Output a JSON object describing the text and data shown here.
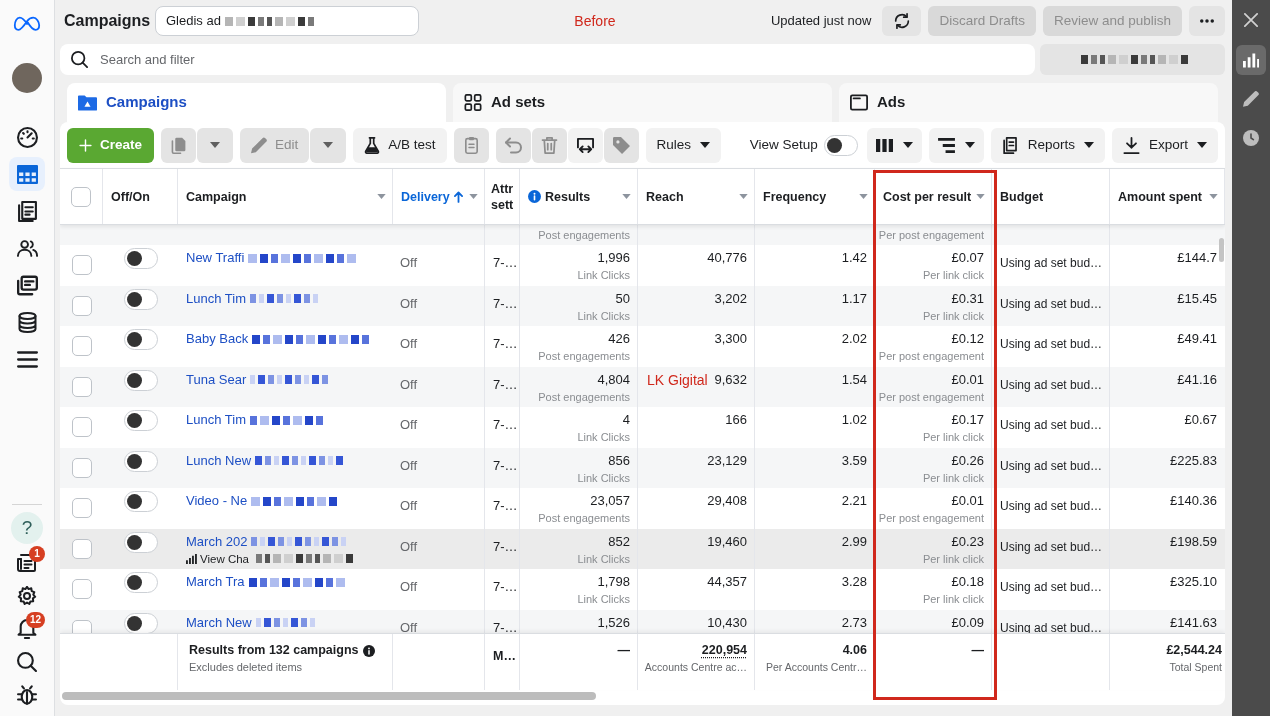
{
  "nav": {
    "top": [
      {
        "selected": false
      },
      {
        "selected": true
      },
      {
        "selected": false
      },
      {
        "selected": false
      },
      {
        "selected": false
      },
      {
        "selected": false
      },
      {
        "selected": false
      }
    ],
    "bottom": [
      {
        "kind": "help",
        "label": "?"
      },
      {
        "kind": "icon",
        "badge": "1"
      },
      {
        "kind": "icon"
      },
      {
        "kind": "icon",
        "badge": "12"
      },
      {
        "kind": "icon"
      },
      {
        "kind": "icon"
      }
    ]
  },
  "header": {
    "title": "Campaigns",
    "account": "Gledis ad",
    "annotation": "Before",
    "updated": "Updated just now",
    "actions": [
      {
        "label": "Discard Drafts",
        "disabled": true
      },
      {
        "label": "Review and publish",
        "disabled": true
      }
    ]
  },
  "search": {
    "placeholder": "Search and filter"
  },
  "tabs": [
    {
      "label": "Campaigns",
      "selected": true
    },
    {
      "label": "Ad sets",
      "selected": false
    },
    {
      "label": "Ads",
      "selected": false
    }
  ],
  "toolbar": {
    "left": [
      {
        "items": [
          {
            "kind": "primary",
            "label": "Create"
          }
        ]
      },
      {
        "items": [
          {
            "kind": "icon",
            "disabled": true
          },
          {
            "kind": "caret",
            "disabled": true
          }
        ]
      },
      {
        "items": [
          {
            "kind": "button",
            "label": "Edit",
            "disabled": true
          },
          {
            "kind": "caret",
            "disabled": true
          }
        ]
      },
      {
        "items": [
          {
            "kind": "button",
            "label": "A/B test",
            "disabled": false
          }
        ]
      },
      {
        "items": [
          {
            "kind": "icon",
            "disabled": true
          }
        ]
      },
      {
        "items": [
          {
            "kind": "icon",
            "disabled": true
          },
          {
            "kind": "icon",
            "disabled": true
          },
          {
            "kind": "icon",
            "disabled": false
          },
          {
            "kind": "icon",
            "disabled": true
          }
        ]
      },
      {
        "items": [
          {
            "kind": "dropdown",
            "label": "Rules",
            "disabled": false
          }
        ]
      }
    ],
    "right": [
      {
        "kind": "toggle",
        "label": "View Setup",
        "on": false
      },
      {
        "kind": "icon_dropdown"
      },
      {
        "kind": "icon_dropdown"
      },
      {
        "kind": "dropdown",
        "label": "Reports",
        "disabled": false
      },
      {
        "kind": "dropdown",
        "label": "Export",
        "disabled": false
      }
    ]
  },
  "table": {
    "select_all": {
      "checked": false
    },
    "columns": [
      {
        "label": "Off/On",
        "menu": false,
        "sorted": false,
        "info": false,
        "highlighted": false
      },
      {
        "label": "Campaign",
        "menu": true,
        "sorted": false,
        "info": false,
        "highlighted": false
      },
      {
        "label": "Delivery",
        "menu": true,
        "sorted": true,
        "info": false,
        "highlighted": false
      },
      {
        "label": "Attr sett",
        "menu": false,
        "sorted": false,
        "info": false,
        "highlighted": false
      },
      {
        "label": "Results",
        "menu": true,
        "sorted": false,
        "info": true,
        "highlighted": false
      },
      {
        "label": "Reach",
        "menu": true,
        "sorted": false,
        "info": false,
        "highlighted": false
      },
      {
        "label": "Frequency",
        "menu": true,
        "sorted": false,
        "info": false,
        "highlighted": false
      },
      {
        "label": "Cost per result",
        "menu": true,
        "sorted": false,
        "info": false,
        "highlighted": true
      },
      {
        "label": "Budget",
        "menu": false,
        "sorted": false,
        "info": false,
        "highlighted": false
      },
      {
        "label": "Amount spent",
        "menu": true,
        "sorted": false,
        "info": false,
        "highlighted": false
      }
    ],
    "rows": [
      {
        "kind": "partial",
        "result_type": "Post engagements",
        "cost_type": "Per post engagement"
      },
      {
        "kind": "campaign",
        "checked": false,
        "on": false,
        "hovered": false,
        "campaign": "New Traffi",
        "delivery": "Off",
        "attribution": "7-…",
        "results": "1,996",
        "result_type": "Link Clicks",
        "reach": "40,776",
        "frequency": "1.42",
        "cost": "£0.07",
        "cost_type": "Per link click",
        "budget": "Using ad set bud…",
        "spent": "£144.7"
      },
      {
        "kind": "campaign",
        "checked": false,
        "on": false,
        "hovered": false,
        "campaign": "Lunch Tim",
        "delivery": "Off",
        "attribution": "7-…",
        "results": "50",
        "result_type": "Link Clicks",
        "reach": "3,202",
        "frequency": "1.17",
        "cost": "£0.31",
        "cost_type": "Per link click",
        "budget": "Using ad set bud…",
        "spent": "£15.45"
      },
      {
        "kind": "campaign",
        "checked": false,
        "on": false,
        "hovered": false,
        "campaign": "Baby Back",
        "delivery": "Off",
        "attribution": "7-…",
        "results": "426",
        "result_type": "Post engagements",
        "reach": "3,300",
        "frequency": "2.02",
        "cost": "£0.12",
        "cost_type": "Per post engagement",
        "budget": "Using ad set bud…",
        "spent": "£49.41"
      },
      {
        "kind": "campaign",
        "checked": false,
        "on": false,
        "hovered": false,
        "campaign": "Tuna Sear",
        "delivery": "Off",
        "attribution": "7-…",
        "results": "4,804",
        "result_type": "Post engagements",
        "note": "LK Gigital",
        "reach": "9,632",
        "frequency": "1.54",
        "cost": "£0.01",
        "cost_type": "Per post engagement",
        "budget": "Using ad set bud…",
        "spent": "£41.16"
      },
      {
        "kind": "campaign",
        "checked": false,
        "on": false,
        "hovered": false,
        "campaign": "Lunch Tim",
        "delivery": "Off",
        "attribution": "7-…",
        "results": "4",
        "result_type": "Link Clicks",
        "reach": "166",
        "frequency": "1.02",
        "cost": "£0.17",
        "cost_type": "Per link click",
        "budget": "Using ad set bud…",
        "spent": "£0.67"
      },
      {
        "kind": "campaign",
        "checked": false,
        "on": false,
        "hovered": false,
        "campaign": "Lunch New",
        "delivery": "Off",
        "attribution": "7-…",
        "results": "856",
        "result_type": "Link Clicks",
        "reach": "23,129",
        "frequency": "3.59",
        "cost": "£0.26",
        "cost_type": "Per link click",
        "budget": "Using ad set bud…",
        "spent": "£225.83"
      },
      {
        "kind": "campaign",
        "checked": false,
        "on": false,
        "hovered": false,
        "campaign": "Video - Ne",
        "delivery": "Off",
        "attribution": "7-…",
        "results": "23,057",
        "result_type": "Post engagements",
        "reach": "29,408",
        "frequency": "2.21",
        "cost": "£0.01",
        "cost_type": "Per post engagement",
        "budget": "Using ad set bud…",
        "spent": "£140.36"
      },
      {
        "kind": "campaign",
        "checked": false,
        "on": false,
        "hovered": true,
        "campaign": "March 202",
        "view_charts": "View Cha",
        "delivery": "Off",
        "attribution": "7-…",
        "results": "852",
        "result_type": "Link Clicks",
        "reach": "19,460",
        "frequency": "2.99",
        "cost": "£0.23",
        "cost_type": "Per link click",
        "budget": "Using ad set bud…",
        "spent": "£198.59"
      },
      {
        "kind": "campaign",
        "checked": false,
        "on": false,
        "hovered": false,
        "campaign": "March Tra",
        "delivery": "Off",
        "attribution": "7-…",
        "results": "1,798",
        "result_type": "Link Clicks",
        "reach": "44,357",
        "frequency": "3.28",
        "cost": "£0.18",
        "cost_type": "Per link click",
        "budget": "Using ad set bud…",
        "spent": "£325.10"
      },
      {
        "kind": "campaign",
        "checked": false,
        "on": false,
        "hovered": false,
        "campaign": "March New",
        "delivery": "Off",
        "attribution": "7-…",
        "results": "1,526",
        "reach": "10,430",
        "frequency": "2.73",
        "cost": "£0.09",
        "budget": "Using ad set bud…",
        "spent": "£141.63"
      }
    ],
    "footer": {
      "title": "Results from 132 campaigns",
      "subtitle": "Excludes deleted items",
      "attribution": "M…",
      "results": "—",
      "reach": "220,954",
      "reach_note": "Accounts Centre ac…",
      "frequency": "4.06",
      "frequency_note": "Per Accounts Centr…",
      "cost": "—",
      "spent": "£2,544.24",
      "spent_note": "Total Spent"
    }
  },
  "side_panel": {
    "items": [
      {
        "selected": true
      },
      {
        "selected": false
      },
      {
        "selected": false
      }
    ]
  }
}
